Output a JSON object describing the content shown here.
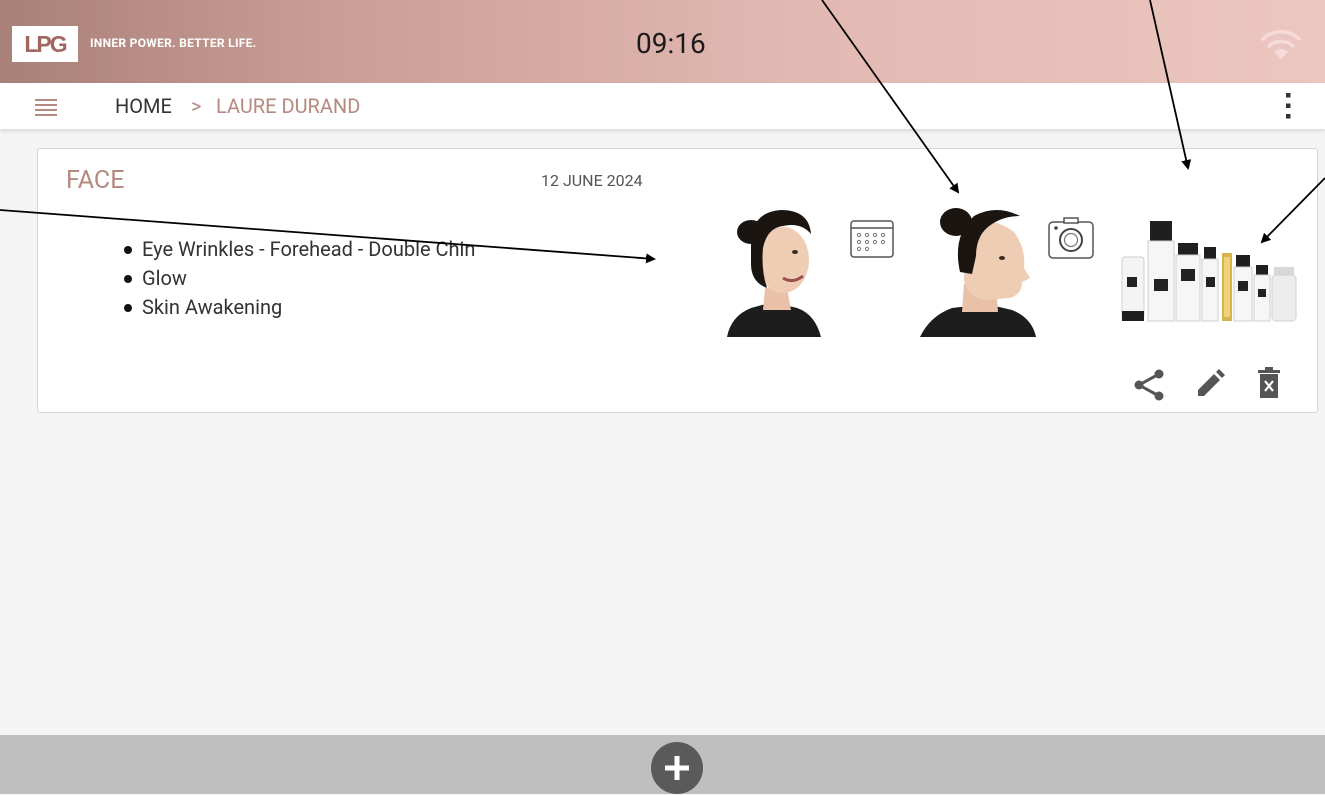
{
  "header": {
    "logo_text": "LPG",
    "tagline": "INNER POWER. BETTER LIFE.",
    "time": "09:16",
    "status_icon": "wifi-icon"
  },
  "nav": {
    "menu_icon": "hamburger-menu-icon",
    "breadcrumb": {
      "home": "HOME",
      "separator": ">",
      "current": "LAURE DURAND"
    },
    "more_icon": "more-vert-icon"
  },
  "card": {
    "title": "FACE",
    "date": "12 JUNE 2024",
    "items": [
      "Eye Wrinkles - Forehead - Double Chin",
      "Glow",
      "Skin Awakening"
    ],
    "icons": {
      "before_photo": "face-photo-smiling",
      "calendar": "calendar-icon",
      "after_photo": "face-photo-profile",
      "camera": "camera-icon",
      "products": "product-bottles-image",
      "share": "share-icon",
      "edit": "edit-pencil-icon",
      "delete": "delete-icon"
    }
  },
  "footer": {
    "add_icon": "add-circle-icon"
  },
  "colors": {
    "accent": "#b5897f",
    "header_start": "#a98078",
    "header_end": "#ecc6c0",
    "footer_bg": "#bfbfbf",
    "icon_gray": "#555555"
  }
}
